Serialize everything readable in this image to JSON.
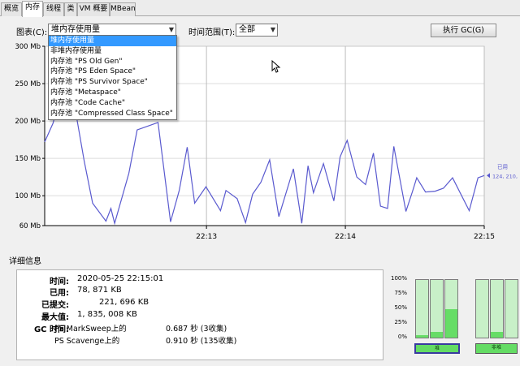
{
  "tabs": [
    {
      "label": "概览",
      "active": false
    },
    {
      "label": "内存",
      "active": true
    },
    {
      "label": "线程",
      "active": false
    },
    {
      "label": "类",
      "active": false
    },
    {
      "label": "VM 概要",
      "active": false
    },
    {
      "label": "MBean",
      "active": false
    }
  ],
  "toolbar": {
    "chart_label": "图表(C):",
    "chart_selected": "堆内存使用量",
    "range_label": "时间范围(T):",
    "range_selected": "全部",
    "gc_button": "执行 GC(G)"
  },
  "dropdown": {
    "items": [
      "堆内存使用量",
      "非堆内存使用量",
      "内存池 \"PS Old Gen\"",
      "内存池 \"PS Eden Space\"",
      "内存池 \"PS Survivor Space\"",
      "内存池 \"Metaspace\"",
      "内存池 \"Code Cache\"",
      "内存池 \"Compressed Class Space\""
    ],
    "selected_index": 0
  },
  "chart_data": {
    "type": "line",
    "ylim": [
      60,
      300
    ],
    "yticks": [
      60,
      100,
      150,
      200,
      250,
      300
    ],
    "ytick_labels": [
      "60 Mb",
      "100 Mb",
      "150 Mb",
      "200 Mb",
      "250 Mb",
      "300 Mb"
    ],
    "xticks": [
      1,
      2,
      3
    ],
    "xtick_labels": [
      "22:13",
      "22:14",
      "22:15"
    ],
    "xlim": [
      -0.165,
      3
    ],
    "series": [
      {
        "name": "已用",
        "color": "#5a5acf",
        "x": [
          -0.165,
          -0.105,
          -0.045,
          -0.012,
          0.051,
          0.12,
          0.18,
          0.276,
          0.312,
          0.339,
          0.441,
          0.501,
          0.651,
          0.741,
          0.804,
          0.861,
          0.915,
          0.996,
          1.101,
          1.14,
          1.221,
          1.281,
          1.332,
          1.392,
          1.455,
          1.521,
          1.626,
          1.686,
          1.731,
          1.77,
          1.842,
          1.917,
          1.962,
          2.013,
          2.082,
          2.145,
          2.202,
          2.253,
          2.304,
          2.349,
          2.436,
          2.484,
          2.514,
          2.577,
          2.646,
          2.706,
          2.772,
          2.892,
          2.955,
          3.0
        ],
        "y": [
          172,
          197,
          240,
          280,
          220,
          146,
          90,
          66,
          83,
          63,
          130,
          188,
          198,
          65,
          107,
          165,
          90,
          112,
          80,
          107,
          96,
          64,
          102,
          118,
          148,
          72,
          136,
          63,
          140,
          104,
          143,
          93,
          152,
          174,
          125,
          115,
          157,
          86,
          83,
          166,
          79,
          106,
          124,
          105,
          106,
          110,
          124,
          80,
          124,
          127
        ],
        "current_label": "已用",
        "current_value": "124, 210,"
      }
    ]
  },
  "details": {
    "title": "详细信息",
    "time_label": "时间:",
    "time_value": "2020-05-25 22:15:01",
    "used_label": "已用:",
    "used_value": "78, 871 KB",
    "committed_label": "已提交:",
    "committed_value": "221, 696 KB",
    "max_label": "最大值:",
    "max_value": "1, 835, 008 KB",
    "gc_label": "GC 时间:",
    "gc_rows": [
      {
        "name": "PS MarkSweep上的",
        "value": "0.687 秒 (3收集)"
      },
      {
        "name": "PS Scavenge上的",
        "value": "0.910 秒 (135收集)"
      }
    ]
  },
  "gauges": {
    "ticks": [
      "100%",
      "75%",
      "50%",
      "25%",
      "0%"
    ],
    "heap_bars": [
      0.04,
      0.1,
      0.5
    ],
    "nonheap_bars": [
      0.0,
      0.1,
      0.0
    ],
    "heap_label": "堆",
    "nonheap_label": "非堆",
    "fill_color": "#66dd66",
    "empty_color": "#c8f0c8"
  }
}
